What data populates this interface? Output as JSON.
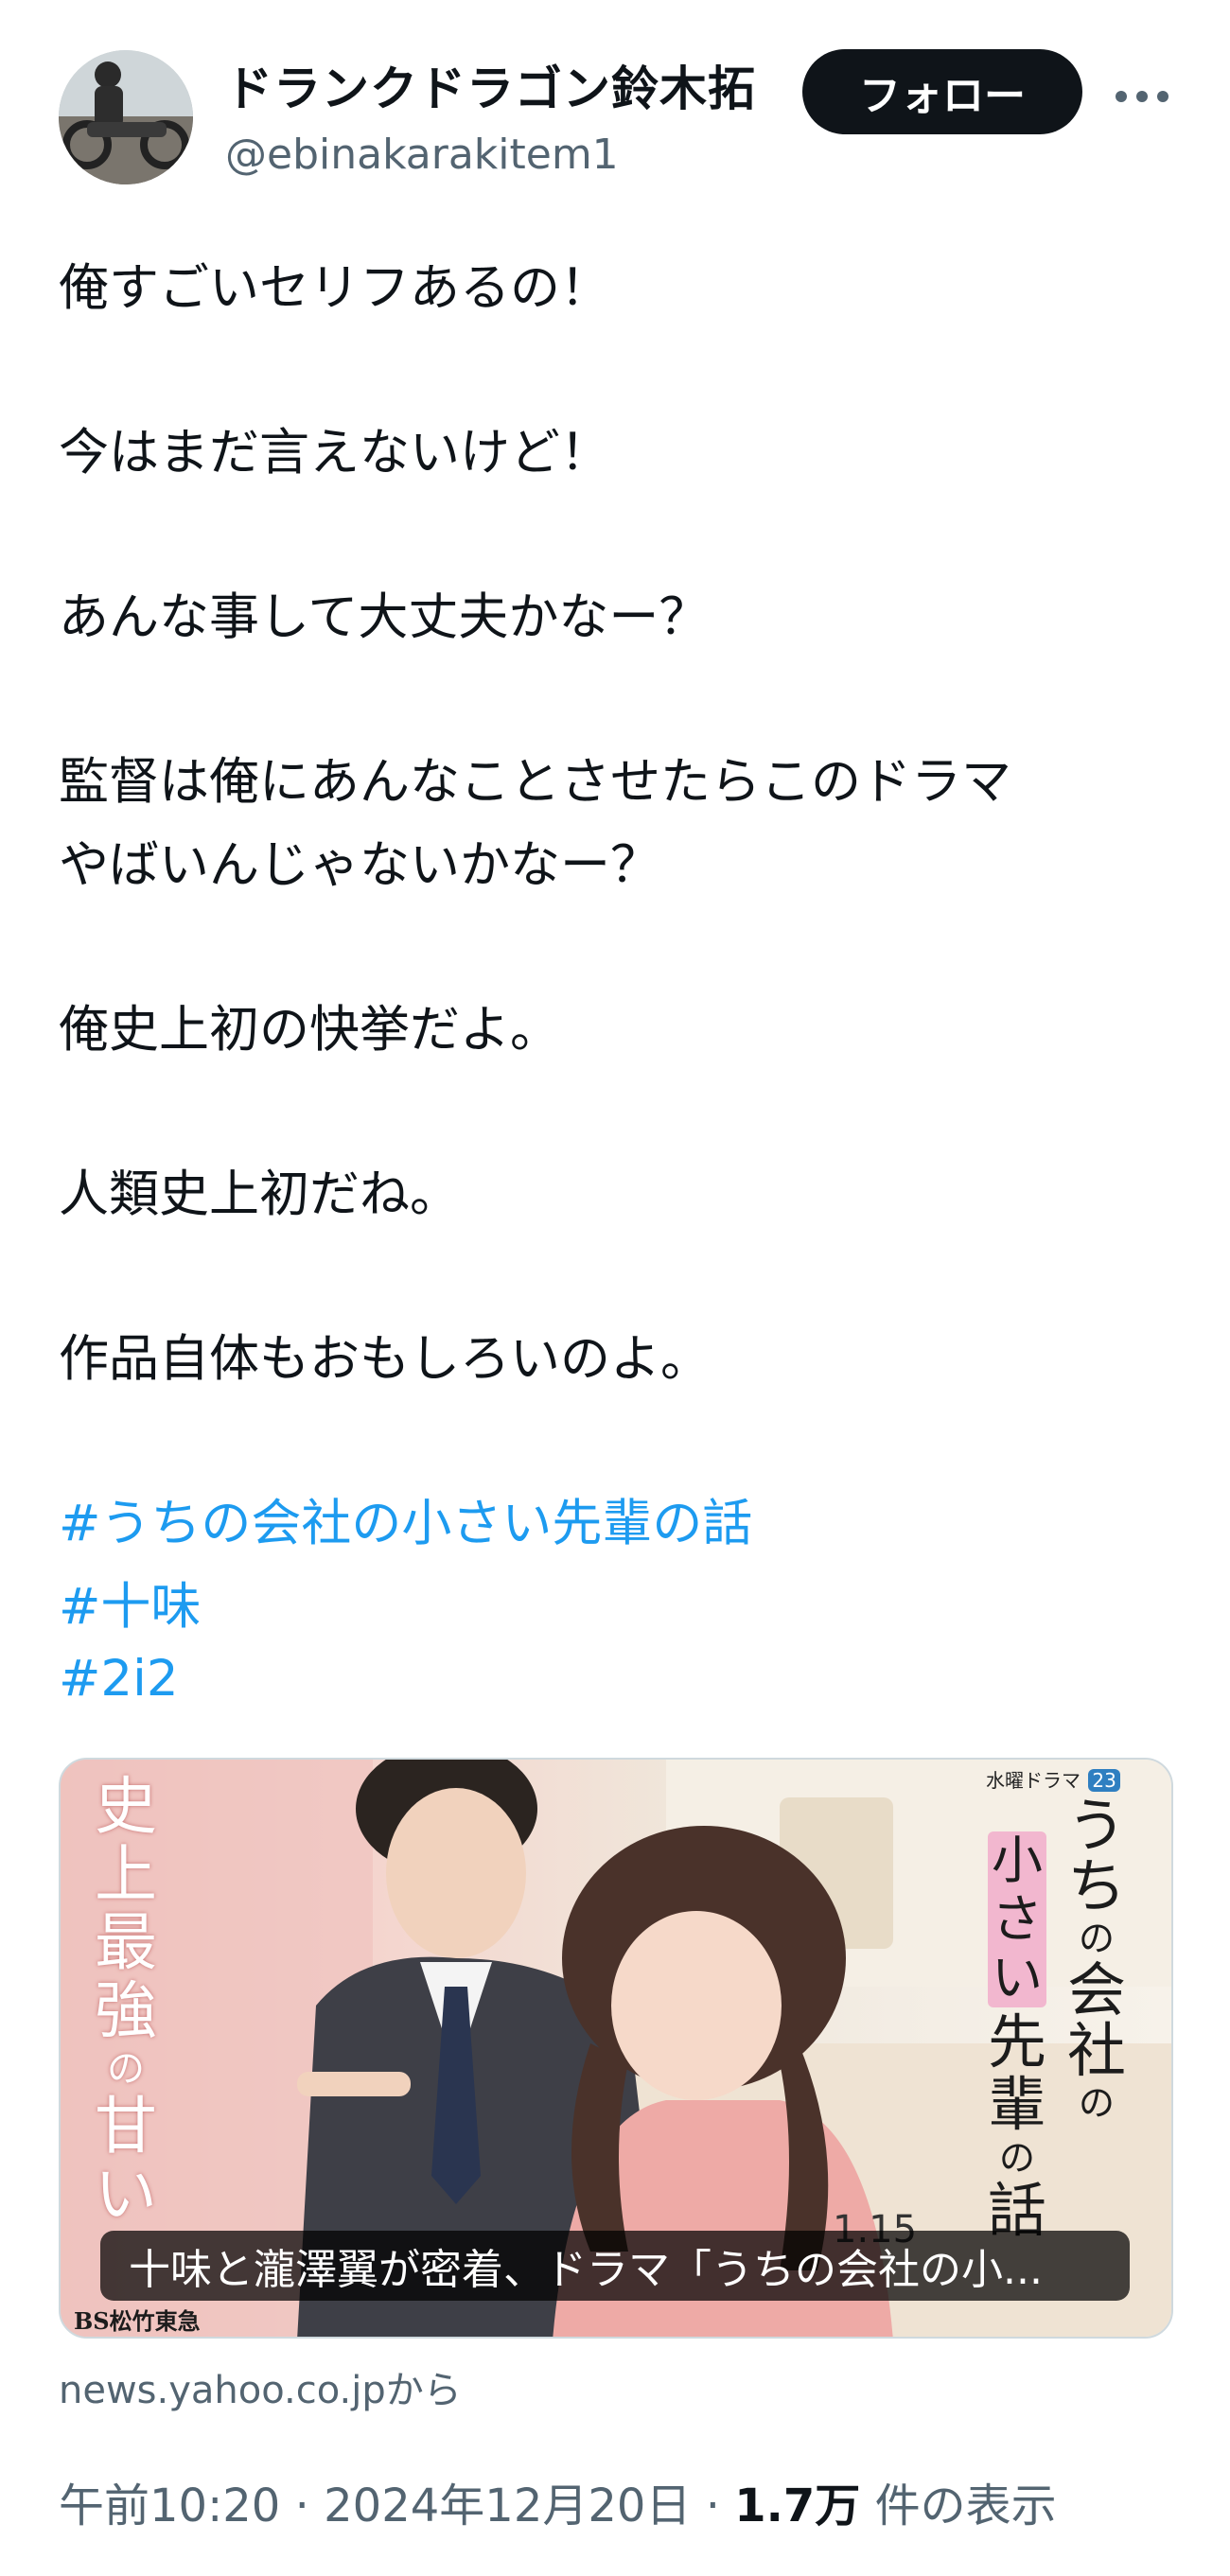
{
  "author": {
    "display_name": "ドランクドラゴン鈴木拓",
    "handle": "@ebinakarakitem1",
    "follow_label": "フォロー",
    "more_icon": "more-dots-icon",
    "avatar_icon": "profile-avatar"
  },
  "tweet": {
    "lines": [
      "俺すごいセリフあるの！",
      "今はまだ言えないけど！",
      "あんな事して大丈夫かなー？",
      "監督は俺にあんなことさせたらこのドラマ",
      "やばいんじゃないかなー？",
      "俺史上初の快挙だよ。",
      "人類史上初だね。",
      "作品自体もおもしろいのよ。"
    ],
    "hashtags": [
      "#うちの会社の小さい先輩の話",
      "#十味",
      "#2i2"
    ]
  },
  "card": {
    "caption": "十味と瀧澤翼が密着、ドラマ「うちの会社の小...",
    "source": "news.yahoo.co.jpから",
    "poster": {
      "left_vertical": [
        "史",
        "上",
        "最",
        "強",
        "の",
        "甘",
        "い"
      ],
      "series_label": "水曜ドラマ",
      "series_num": "23",
      "title_vertical_1": [
        "う",
        "ち",
        "の",
        "会",
        "社",
        "の"
      ],
      "title_small": [
        "小",
        "さ",
        "い"
      ],
      "title_vertical_2": [
        "先",
        "輩",
        "の",
        "話"
      ],
      "date_text": "1.15",
      "channel": "BS松竹東急"
    }
  },
  "meta": {
    "time": "午前10:20",
    "separator": "·",
    "date": "2024年12月20日",
    "views_count": "1.7万",
    "views_label": "件の表示"
  }
}
